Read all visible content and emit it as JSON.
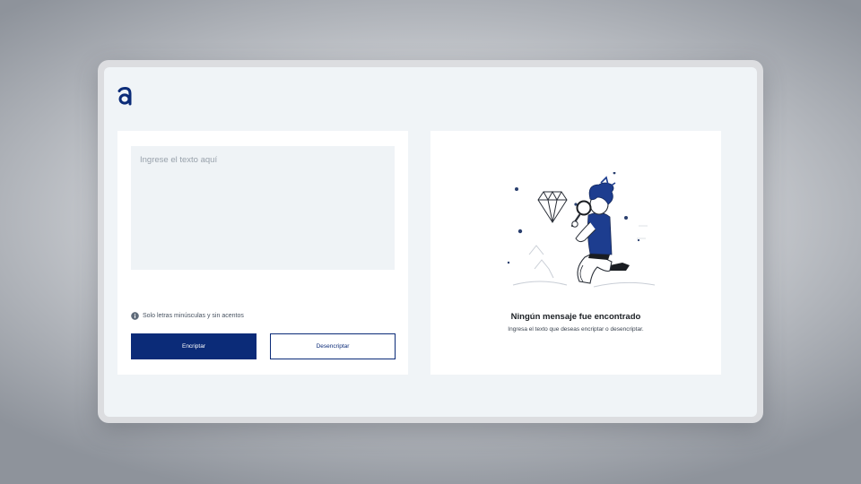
{
  "app": {
    "logo_icon": "alura-a-logo-icon",
    "accent_color": "#0b2b78",
    "background_color": "#f0f4f7"
  },
  "editor": {
    "placeholder": "Ingrese el texto aquí",
    "value": "",
    "hint_icon": "info-icon",
    "hint": "Solo letras minúsculas y sin acentos"
  },
  "actions": {
    "encrypt_label": "Encriptar",
    "decrypt_label": "Desencriptar"
  },
  "output": {
    "illustration": "person-with-magnifying-glass-and-diamond",
    "title": "Ningún mensaje fue encontrado",
    "description": "Ingresa el texto que deseas encriptar o desencriptar."
  }
}
